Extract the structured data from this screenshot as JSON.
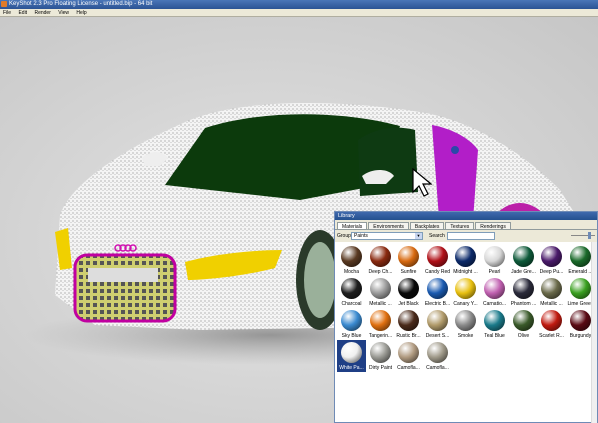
{
  "window": {
    "title": "KeyShot 2.3 Pro Floating License - untitled.bip - 64 bit"
  },
  "menu": [
    "File",
    "Edit",
    "Render",
    "View",
    "Help"
  ],
  "library": {
    "title": "Library",
    "tabs": [
      "Materials",
      "Environments",
      "Backplates",
      "Textures",
      "Renderings"
    ],
    "active_tab": "Materials",
    "group_label": "Group",
    "group_value": "Paints",
    "search_label": "Search",
    "search_value": "",
    "swatches": [
      {
        "name": "Mocha",
        "color": "#5a3a22"
      },
      {
        "name": "Deep Ch...",
        "color": "#8a2a10"
      },
      {
        "name": "Sunfire",
        "color": "#d86a10"
      },
      {
        "name": "Candy Red",
        "color": "#b01018"
      },
      {
        "name": "Midnight ...",
        "color": "#0c2a6a"
      },
      {
        "name": "Pearl",
        "color": "#d8d8d8"
      },
      {
        "name": "Jade Gre...",
        "color": "#0e5a3a"
      },
      {
        "name": "Deep Pu...",
        "color": "#4a1a6a"
      },
      {
        "name": "Emerald ...",
        "color": "#1a6a2a"
      },
      {
        "name": "Charcoal",
        "color": "#1e1e1e"
      },
      {
        "name": "Metallic ...",
        "color": "#9a9a9a"
      },
      {
        "name": "Jet Black",
        "color": "#0a0a0a"
      },
      {
        "name": "Electric B...",
        "color": "#1a5ab0"
      },
      {
        "name": "Canary Y...",
        "color": "#e8c010"
      },
      {
        "name": "Carnatio...",
        "color": "#c060b0"
      },
      {
        "name": "Phantom ...",
        "color": "#2a2a3a"
      },
      {
        "name": "Metallic ...",
        "color": "#6a6a4a"
      },
      {
        "name": "Lime Green",
        "color": "#3aa020"
      },
      {
        "name": "Sky Blue",
        "color": "#3a8ad0"
      },
      {
        "name": "Tangerin...",
        "color": "#e07010"
      },
      {
        "name": "Rustic Br...",
        "color": "#4a2a1a"
      },
      {
        "name": "Desert S...",
        "color": "#b09a6a"
      },
      {
        "name": "Smoke",
        "color": "#8a8a8a"
      },
      {
        "name": "Teal Blue",
        "color": "#1a7a8a"
      },
      {
        "name": "Olive",
        "color": "#3a5a2a"
      },
      {
        "name": "Scarlet R...",
        "color": "#c01a10"
      },
      {
        "name": "Burgundy",
        "color": "#5a0a14"
      },
      {
        "name": "White Pa...",
        "color": "#f0f0f0",
        "selected": true
      },
      {
        "name": "Dirty Paint",
        "color": "#9a9a94"
      },
      {
        "name": "Camofla...",
        "color": "#b09a80"
      },
      {
        "name": "Camofla...",
        "color": "#a09a8a"
      }
    ]
  },
  "viewport": {
    "background": "#d4d4d4",
    "car_paint": "#ffffff",
    "windshield": "#0c3a0c",
    "accent_magenta": "#b21ec8",
    "accent_yellow": "#f0d000",
    "grille_yellow": "#d8d060"
  }
}
